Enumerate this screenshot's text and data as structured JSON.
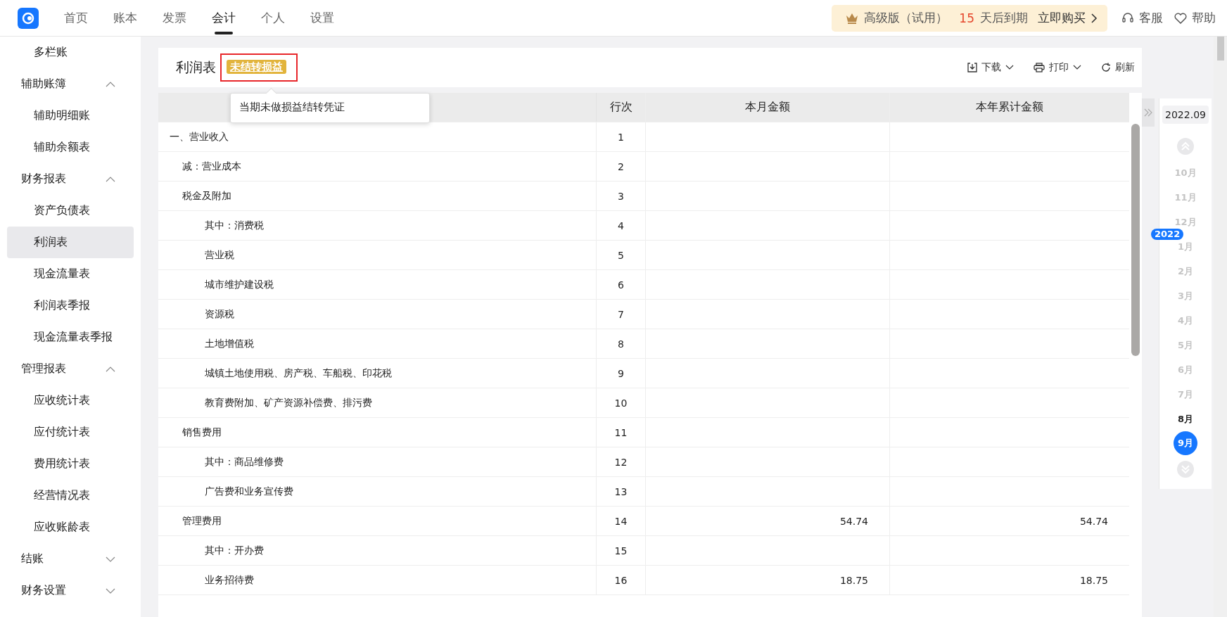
{
  "nav": {
    "tabs": [
      {
        "label": "首页",
        "selected": false
      },
      {
        "label": "账本",
        "selected": false
      },
      {
        "label": "发票",
        "selected": false
      },
      {
        "label": "会计",
        "selected": true
      },
      {
        "label": "个人",
        "selected": false
      },
      {
        "label": "设置",
        "selected": false
      }
    ],
    "promo": {
      "edition": "高级版（试用）",
      "days": "15",
      "days_suffix": "天后到期",
      "buy": "立即购买"
    },
    "links": [
      "客服",
      "帮助"
    ]
  },
  "sidebar": [
    {
      "label": "多栏账",
      "selected": false
    },
    {
      "label": "辅助账簿",
      "expanded": true,
      "children": [
        {
          "label": "辅助明细账",
          "selected": false
        },
        {
          "label": "辅助余额表",
          "selected": false
        }
      ]
    },
    {
      "label": "财务报表",
      "expanded": true,
      "children": [
        {
          "label": "资产负债表",
          "selected": false
        },
        {
          "label": "利润表",
          "selected": true
        },
        {
          "label": "现金流量表",
          "selected": false
        },
        {
          "label": "利润表季报",
          "selected": false
        },
        {
          "label": "现金流量表季报",
          "selected": false
        }
      ]
    },
    {
      "label": "管理报表",
      "expanded": true,
      "children": [
        {
          "label": "应收统计表",
          "selected": false
        },
        {
          "label": "应付统计表",
          "selected": false
        },
        {
          "label": "费用统计表",
          "selected": false
        },
        {
          "label": "经营情况表",
          "selected": false
        },
        {
          "label": "应收账龄表",
          "selected": false
        }
      ]
    },
    {
      "label": "结账",
      "expanded": false
    },
    {
      "label": "财务设置",
      "expanded": false
    }
  ],
  "report": {
    "title": "利润表",
    "tag": "未结转损益",
    "tooltip": "当期未做损益结转凭证",
    "actions": [
      "下载",
      "打印",
      "刷新"
    ],
    "columns": [
      "行次",
      "本月金额",
      "本年累计金额"
    ],
    "rows": [
      {
        "name": "一、营业收入",
        "line": "1",
        "children": [
          {
            "name": "减：营业成本",
            "line": "2"
          },
          {
            "name": "税金及附加",
            "line": "3",
            "children": [
              {
                "name": "其中：消费税",
                "line": "4"
              },
              {
                "name": "营业税",
                "line": "5"
              },
              {
                "name": "城市维护建设税",
                "line": "6"
              },
              {
                "name": "资源税",
                "line": "7"
              },
              {
                "name": "土地增值税",
                "line": "8"
              },
              {
                "name": "城镇土地使用税、房产税、车船税、印花税",
                "line": "9"
              },
              {
                "name": "教育费附加、矿产资源补偿费、排污费",
                "line": "10"
              }
            ]
          },
          {
            "name": "销售费用",
            "line": "11",
            "children": [
              {
                "name": "其中：商品维修费",
                "line": "12"
              },
              {
                "name": "广告费和业务宣传费",
                "line": "13"
              }
            ]
          },
          {
            "name": "管理费用",
            "line": "14",
            "month": "54.74",
            "year": "54.74",
            "children": [
              {
                "name": "其中：开办费",
                "line": "15"
              },
              {
                "name": "业务招待费",
                "line": "16",
                "month": "18.75",
                "year": "18.75"
              }
            ]
          }
        ]
      }
    ]
  },
  "period": {
    "current": "2022.09",
    "months": [
      {
        "kind": "month",
        "label": "10月",
        "disabled": true,
        "selected": false
      },
      {
        "kind": "month",
        "label": "11月",
        "disabled": true,
        "selected": false
      },
      {
        "kind": "month",
        "label": "12月",
        "disabled": true,
        "selected": false
      },
      {
        "kind": "year",
        "label": "2022"
      },
      {
        "kind": "month",
        "label": "1月",
        "disabled": true,
        "selected": false
      },
      {
        "kind": "month",
        "label": "2月",
        "disabled": true,
        "selected": false
      },
      {
        "kind": "month",
        "label": "3月",
        "disabled": true,
        "selected": false
      },
      {
        "kind": "month",
        "label": "4月",
        "disabled": true,
        "selected": false
      },
      {
        "kind": "month",
        "label": "5月",
        "disabled": true,
        "selected": false
      },
      {
        "kind": "month",
        "label": "6月",
        "disabled": true,
        "selected": false
      },
      {
        "kind": "month",
        "label": "7月",
        "disabled": true,
        "selected": false
      },
      {
        "kind": "month",
        "label": "8月",
        "disabled": false,
        "selected": false
      },
      {
        "kind": "month",
        "label": "9月",
        "disabled": false,
        "selected": true
      }
    ]
  }
}
